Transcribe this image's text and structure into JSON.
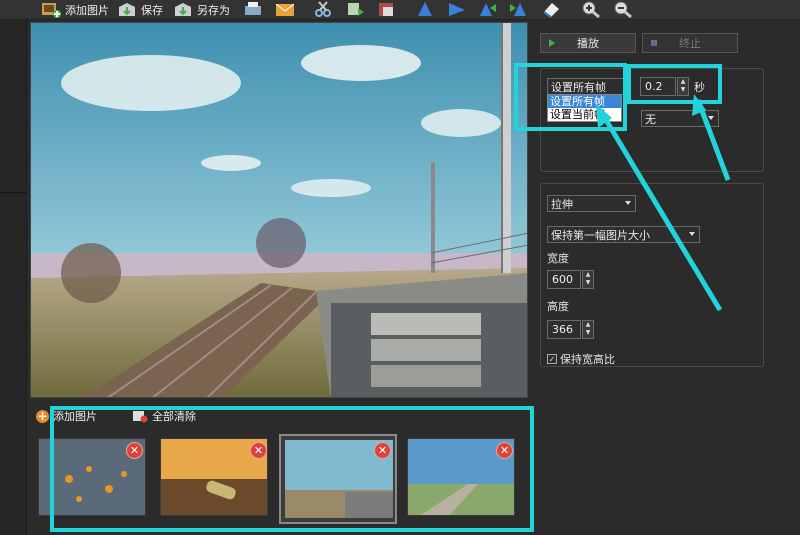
{
  "toolbar": {
    "add_image": "添加图片",
    "save": "保存",
    "save_as": "另存为"
  },
  "thumbs": {
    "add_image": "添加图片",
    "clear_all": "全部清除",
    "delete_symbol": "✕"
  },
  "playback": {
    "play": "播放",
    "stop": "终止"
  },
  "frame": {
    "mode_selected": "设置所有帧",
    "mode_options": [
      "设置所有帧",
      "设置当前帧"
    ],
    "delay_value": "0.2",
    "delay_unit": "秒",
    "transition": "无"
  },
  "sizing": {
    "scale_mode": "拉伸",
    "size_mode": "保持第一幅图片大小",
    "width_label": "宽度",
    "width_value": "600",
    "height_label": "高度",
    "height_value": "366",
    "keep_ratio_label": "保持宽高比",
    "keep_ratio_checked": true
  },
  "colors": {
    "highlight": "#22d3d9"
  }
}
